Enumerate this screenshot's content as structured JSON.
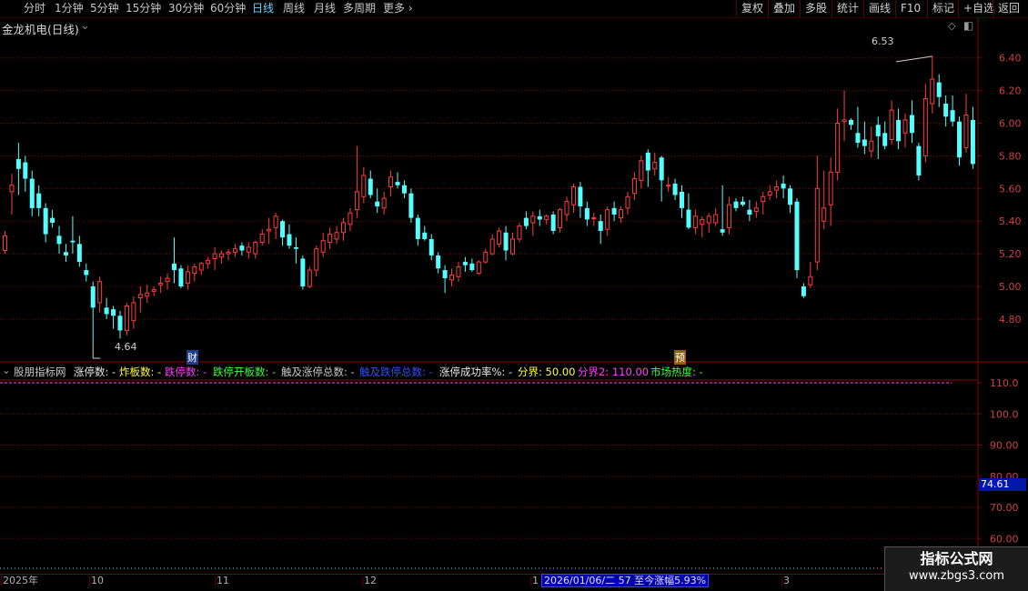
{
  "toolbar": {
    "period_tabs": [
      {
        "label": "分时",
        "active": false
      },
      {
        "label": "1分钟",
        "active": false
      },
      {
        "label": "5分钟",
        "active": false
      },
      {
        "label": "15分钟",
        "active": false
      },
      {
        "label": "30分钟",
        "active": false
      },
      {
        "label": "60分钟",
        "active": false
      },
      {
        "label": "日线",
        "active": true
      },
      {
        "label": "周线",
        "active": false
      },
      {
        "label": "月线",
        "active": false
      },
      {
        "label": "多周期",
        "active": false
      },
      {
        "label": "更多",
        "active": false
      }
    ],
    "right_buttons": [
      "复权",
      "叠加",
      "多股",
      "统计",
      "画线",
      "F10",
      "标记",
      "+自选",
      "返回"
    ]
  },
  "main_panel": {
    "title": "金龙机电(日线)",
    "high_label": "6.53",
    "low_label": "4.64",
    "marker_cai": "财",
    "marker_yu": "预"
  },
  "indicator_panel": {
    "legend": [
      {
        "text": "股朋指标网",
        "color": "#c8c8c8"
      },
      {
        "text": "涨停数: -",
        "color": "#e8e8e8"
      },
      {
        "text": "炸板数: -",
        "color": "#ffff40"
      },
      {
        "text": "跌停数: -",
        "color": "#ff40ff"
      },
      {
        "text": "跌停开板数: -",
        "color": "#40ff40"
      },
      {
        "text": "触及涨停总数: -",
        "color": "#c8c8c8"
      },
      {
        "text": "触及跌停总数: -",
        "color": "#3050ff"
      },
      {
        "text": "涨停成功率%: -",
        "color": "#e8e8e8"
      },
      {
        "text": "分界: 50.00",
        "color": "#ffff40"
      },
      {
        "text": "分界2: 110.00",
        "color": "#ff40ff"
      },
      {
        "text": "市场热度: -",
        "color": "#40ff40"
      }
    ],
    "current_value": "74.61"
  },
  "date_bar": {
    "labels": [
      "2025年",
      "10",
      "11",
      "12",
      "1",
      "3"
    ],
    "highlight": "2026/01/06/二 57 至今涨幅5.93%"
  },
  "watermark": {
    "line1": "指标公式网",
    "line2": "www.zbgs3.com"
  },
  "colors": {
    "up": "#ff3c3c",
    "down": "#54ffff",
    "grid": "#7a0000",
    "axis": "#8b0000"
  },
  "chart_data": {
    "type": "candlestick",
    "ylim": [
      4.6,
      6.53
    ],
    "y_ticks": [
      4.8,
      5.0,
      5.2,
      5.4,
      5.6,
      5.8,
      6.0,
      6.2,
      6.4
    ],
    "indicator_y_ticks": [
      60.0,
      70.0,
      80.0,
      90.0,
      100.0,
      110.0
    ],
    "candles": [
      [
        5.22,
        5.34,
        5.2,
        5.31
      ],
      [
        5.58,
        5.69,
        5.44,
        5.62
      ],
      [
        5.78,
        5.88,
        5.56,
        5.72
      ],
      [
        5.76,
        5.8,
        5.58,
        5.66
      ],
      [
        5.66,
        5.71,
        5.43,
        5.48
      ],
      [
        5.57,
        5.62,
        5.43,
        5.48
      ],
      [
        5.48,
        5.51,
        5.27,
        5.32
      ],
      [
        5.42,
        5.47,
        5.36,
        5.39
      ],
      [
        5.31,
        5.37,
        5.2,
        5.26
      ],
      [
        5.21,
        5.26,
        5.15,
        5.19
      ],
      [
        5.28,
        5.43,
        5.2,
        5.27
      ],
      [
        5.26,
        5.31,
        5.12,
        5.15
      ],
      [
        5.1,
        5.14,
        5.03,
        5.07
      ],
      [
        5.0,
        5.03,
        4.66,
        4.87
      ],
      [
        4.9,
        5.06,
        4.84,
        5.03
      ],
      [
        4.87,
        4.93,
        4.8,
        4.83
      ],
      [
        4.86,
        4.88,
        4.74,
        4.82
      ],
      [
        4.82,
        4.85,
        4.68,
        4.73
      ],
      [
        4.73,
        4.9,
        4.7,
        4.88
      ],
      [
        4.79,
        4.94,
        4.74,
        4.9
      ],
      [
        4.93,
        5.0,
        4.84,
        4.95
      ],
      [
        4.94,
        5.01,
        4.9,
        4.96
      ],
      [
        4.97,
        5.0,
        4.94,
        4.98
      ],
      [
        5.01,
        5.06,
        4.96,
        5.02
      ],
      [
        5.03,
        5.08,
        4.98,
        5.05
      ],
      [
        5.14,
        5.3,
        5.02,
        5.1
      ],
      [
        5.11,
        5.13,
        4.99,
        5.0
      ],
      [
        5.02,
        5.13,
        4.98,
        5.09
      ],
      [
        5.08,
        5.14,
        5.03,
        5.12
      ],
      [
        5.1,
        5.15,
        5.07,
        5.14
      ],
      [
        5.14,
        5.18,
        5.11,
        5.16
      ],
      [
        5.17,
        5.24,
        5.1,
        5.2
      ],
      [
        5.18,
        5.22,
        5.14,
        5.2
      ],
      [
        5.2,
        5.23,
        5.16,
        5.21
      ],
      [
        5.21,
        5.26,
        5.18,
        5.23
      ],
      [
        5.25,
        5.27,
        5.19,
        5.22
      ],
      [
        5.21,
        5.27,
        5.17,
        5.24
      ],
      [
        5.2,
        5.28,
        5.17,
        5.27
      ],
      [
        5.27,
        5.35,
        5.25,
        5.32
      ],
      [
        5.34,
        5.42,
        5.26,
        5.35
      ],
      [
        5.36,
        5.45,
        5.29,
        5.43
      ],
      [
        5.4,
        5.41,
        5.25,
        5.3
      ],
      [
        5.32,
        5.38,
        5.23,
        5.25
      ],
      [
        5.24,
        5.3,
        5.14,
        5.23
      ],
      [
        5.17,
        5.19,
        4.98,
        5.0
      ],
      [
        5.0,
        5.12,
        4.99,
        5.1
      ],
      [
        5.1,
        5.25,
        5.06,
        5.23
      ],
      [
        5.21,
        5.33,
        5.18,
        5.28
      ],
      [
        5.27,
        5.36,
        5.23,
        5.32
      ],
      [
        5.29,
        5.37,
        5.26,
        5.33
      ],
      [
        5.33,
        5.42,
        5.28,
        5.39
      ],
      [
        5.38,
        5.48,
        5.34,
        5.45
      ],
      [
        5.47,
        5.86,
        5.42,
        5.58
      ],
      [
        5.55,
        5.73,
        5.51,
        5.68
      ],
      [
        5.66,
        5.71,
        5.54,
        5.56
      ],
      [
        5.52,
        5.6,
        5.45,
        5.49
      ],
      [
        5.48,
        5.58,
        5.44,
        5.54
      ],
      [
        5.61,
        5.71,
        5.55,
        5.67
      ],
      [
        5.64,
        5.7,
        5.6,
        5.62
      ],
      [
        5.62,
        5.65,
        5.54,
        5.57
      ],
      [
        5.57,
        5.6,
        5.39,
        5.42
      ],
      [
        5.42,
        5.44,
        5.25,
        5.29
      ],
      [
        5.33,
        5.37,
        5.28,
        5.29
      ],
      [
        5.29,
        5.32,
        5.16,
        5.19
      ],
      [
        5.19,
        5.21,
        5.08,
        5.11
      ],
      [
        5.1,
        5.13,
        4.96,
        5.05
      ],
      [
        5.04,
        5.11,
        5.0,
        5.07
      ],
      [
        5.06,
        5.15,
        5.03,
        5.12
      ],
      [
        5.15,
        5.18,
        5.09,
        5.13
      ],
      [
        5.14,
        5.17,
        5.09,
        5.1
      ],
      [
        5.08,
        5.16,
        5.07,
        5.15
      ],
      [
        5.15,
        5.23,
        5.14,
        5.21
      ],
      [
        5.2,
        5.32,
        5.19,
        5.29
      ],
      [
        5.26,
        5.36,
        5.24,
        5.34
      ],
      [
        5.33,
        5.37,
        5.16,
        5.22
      ],
      [
        5.2,
        5.33,
        5.19,
        5.29
      ],
      [
        5.29,
        5.39,
        5.27,
        5.37
      ],
      [
        5.42,
        5.46,
        5.35,
        5.37
      ],
      [
        5.39,
        5.46,
        5.31,
        5.43
      ],
      [
        5.43,
        5.47,
        5.37,
        5.41
      ],
      [
        5.41,
        5.44,
        5.38,
        5.43
      ],
      [
        5.44,
        5.46,
        5.32,
        5.34
      ],
      [
        5.36,
        5.48,
        5.33,
        5.47
      ],
      [
        5.44,
        5.55,
        5.4,
        5.52
      ],
      [
        5.5,
        5.63,
        5.45,
        5.61
      ],
      [
        5.61,
        5.64,
        5.42,
        5.49
      ],
      [
        5.48,
        5.52,
        5.37,
        5.41
      ],
      [
        5.42,
        5.45,
        5.37,
        5.42
      ],
      [
        5.4,
        5.44,
        5.26,
        5.34
      ],
      [
        5.35,
        5.49,
        5.31,
        5.47
      ],
      [
        5.48,
        5.52,
        5.4,
        5.44
      ],
      [
        5.42,
        5.49,
        5.39,
        5.47
      ],
      [
        5.48,
        5.58,
        5.44,
        5.55
      ],
      [
        5.57,
        5.7,
        5.53,
        5.66
      ],
      [
        5.65,
        5.8,
        5.6,
        5.77
      ],
      [
        5.82,
        5.84,
        5.61,
        5.71
      ],
      [
        5.72,
        5.82,
        5.68,
        5.76
      ],
      [
        5.79,
        5.8,
        5.52,
        5.65
      ],
      [
        5.62,
        5.67,
        5.58,
        5.62
      ],
      [
        5.63,
        5.66,
        5.53,
        5.56
      ],
      [
        5.58,
        5.62,
        5.42,
        5.48
      ],
      [
        5.47,
        5.57,
        5.35,
        5.36
      ],
      [
        5.36,
        5.47,
        5.32,
        5.43
      ],
      [
        5.38,
        5.43,
        5.3,
        5.41
      ],
      [
        5.39,
        5.45,
        5.33,
        5.43
      ],
      [
        5.39,
        5.48,
        5.37,
        5.44
      ],
      [
        5.35,
        5.62,
        5.31,
        5.33
      ],
      [
        5.36,
        5.55,
        5.32,
        5.5
      ],
      [
        5.52,
        5.54,
        5.46,
        5.48
      ],
      [
        5.52,
        5.55,
        5.49,
        5.5
      ],
      [
        5.47,
        5.53,
        5.4,
        5.44
      ],
      [
        5.46,
        5.52,
        5.42,
        5.48
      ],
      [
        5.52,
        5.58,
        5.44,
        5.55
      ],
      [
        5.56,
        5.62,
        5.53,
        5.58
      ],
      [
        5.59,
        5.65,
        5.54,
        5.61
      ],
      [
        5.63,
        5.68,
        5.54,
        5.6
      ],
      [
        5.6,
        5.62,
        5.45,
        5.5
      ],
      [
        5.52,
        5.54,
        5.05,
        5.1
      ],
      [
        5.0,
        5.02,
        4.93,
        4.94
      ],
      [
        5.01,
        5.15,
        4.99,
        5.06
      ],
      [
        5.15,
        5.8,
        5.1,
        5.6
      ],
      [
        5.4,
        5.71,
        5.35,
        5.48
      ],
      [
        5.5,
        5.79,
        5.37,
        5.7
      ],
      [
        5.7,
        6.09,
        5.65,
        6.0
      ],
      [
        6.01,
        6.2,
        5.89,
        6.02
      ],
      [
        6.02,
        6.03,
        5.96,
        5.99
      ],
      [
        5.94,
        6.1,
        5.85,
        5.88
      ],
      [
        5.9,
        6.01,
        5.81,
        5.86
      ],
      [
        5.83,
        5.98,
        5.79,
        5.89
      ],
      [
        5.99,
        6.04,
        5.78,
        5.92
      ],
      [
        5.94,
        6.01,
        5.84,
        5.86
      ],
      [
        5.9,
        6.14,
        5.87,
        6.08
      ],
      [
        6.02,
        6.09,
        5.84,
        5.89
      ],
      [
        5.94,
        6.06,
        5.85,
        6.02
      ],
      [
        6.05,
        6.14,
        5.88,
        5.94
      ],
      [
        5.86,
        5.88,
        5.65,
        5.68
      ],
      [
        5.8,
        6.24,
        5.76,
        6.15
      ],
      [
        6.12,
        6.41,
        6.06,
        6.27
      ],
      [
        6.25,
        6.3,
        6.1,
        6.16
      ],
      [
        6.12,
        6.17,
        5.98,
        6.04
      ],
      [
        6.08,
        6.17,
        5.98,
        6.01
      ],
      [
        6.01,
        6.04,
        5.74,
        5.79
      ],
      [
        5.85,
        6.18,
        5.82,
        6.05
      ],
      [
        6.02,
        6.1,
        5.72,
        5.75
      ]
    ]
  }
}
